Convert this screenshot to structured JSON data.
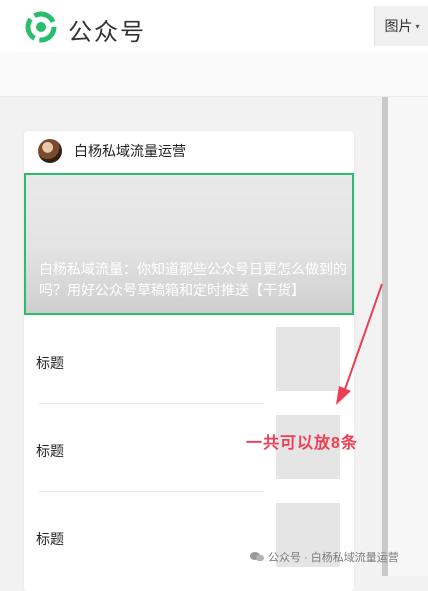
{
  "header": {
    "brand": "公众号",
    "menu_label": "图片",
    "logo_icon": "wechat-official-account-logo",
    "accent": "#2bbd6e"
  },
  "card": {
    "account_name": "白杨私域流量运营",
    "featured_title": "白杨私域流量：你知道那些公众号日更怎么做到的吗？用好公众号草稿箱和定时推送【干货】",
    "items": [
      {
        "label": "标题"
      },
      {
        "label": "标题"
      },
      {
        "label": "标题"
      }
    ]
  },
  "annotation": {
    "text": "一共可以放8条",
    "color": "#ef3d53"
  },
  "watermark": {
    "text": "公众号 · 白杨私域流量运营"
  }
}
